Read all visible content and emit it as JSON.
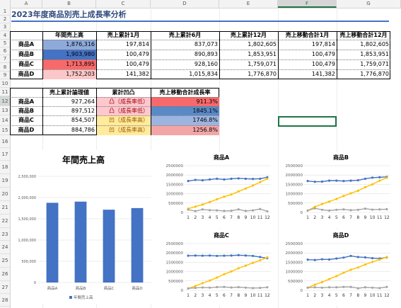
{
  "sheet": {
    "columns": [
      "A",
      "B",
      "C",
      "D",
      "E",
      "F",
      "G"
    ],
    "selected_column": "F",
    "rows": [
      "1",
      "2",
      "3",
      "4",
      "5",
      "6",
      "7",
      "8",
      "9",
      "10",
      "11",
      "12",
      "13",
      "14",
      "15",
      "16",
      "17",
      "18",
      "19",
      "20",
      "21",
      "22",
      "23",
      "24",
      "25",
      "26",
      "27",
      "28",
      "29",
      "30",
      "31",
      "32",
      "33",
      "34"
    ],
    "selected_row": "12"
  },
  "title": "2023年度商品別売上成長率分析",
  "table1": {
    "headers": [
      "年間売上高",
      "売上累計1月",
      "売上累計6月",
      "売上累計12月",
      "売上移動合計1月",
      "売上移動合計12月"
    ],
    "rows": [
      {
        "label": "商品A",
        "values": [
          "1,876,316",
          "197,814",
          "837,073",
          "1,802,605",
          "197,814",
          "1,802,605"
        ]
      },
      {
        "label": "商品B",
        "values": [
          "1,903,980",
          "100,479",
          "890,893",
          "1,853,951",
          "100,479",
          "1,853,951"
        ]
      },
      {
        "label": "商品C",
        "values": [
          "1,713,895",
          "100,479",
          "928,160",
          "1,759,071",
          "100,479",
          "1,759,071"
        ]
      },
      {
        "label": "商品D",
        "values": [
          "1,752,203",
          "141,382",
          "1,015,834",
          "1,776,870",
          "141,382",
          "1,776,870"
        ]
      }
    ],
    "b_fill": [
      "#8eaadb",
      "#4472c4",
      "#f8696b",
      "#fbc7c8"
    ]
  },
  "table2": {
    "headers": [
      "売上累計論理値",
      "累計凹凸",
      "売上移動合計成長率"
    ],
    "rows": [
      {
        "label": "商品A",
        "value": "927,264",
        "shape": "凸（成長率低）",
        "rate": "911.3%"
      },
      {
        "label": "商品B",
        "value": "897,512",
        "shape": "凸（成長率低）",
        "rate": "1845.1%"
      },
      {
        "label": "商品C",
        "value": "854,507",
        "shape": "凹（成長率高）",
        "rate": "1746.8%"
      },
      {
        "label": "商品D",
        "value": "884,786",
        "shape": "凹（成長率高）",
        "rate": "1256.8%"
      }
    ],
    "shape_fill": [
      "#ffc7ce",
      "#ffc7ce",
      "#ffeb9c",
      "#ffeb9c"
    ],
    "shape_color": [
      "#9c0006",
      "#9c0006",
      "#9c5700",
      "#9c5700"
    ],
    "rate_fill": [
      "#f8696b",
      "#5a8ac6",
      "#9cb4e0",
      "#f3a5a6"
    ]
  },
  "chart_data": [
    {
      "type": "bar",
      "title": "年間売上高",
      "categories": [
        "商品A",
        "商品B",
        "商品C",
        "商品D"
      ],
      "series": [
        {
          "name": "年間売上高",
          "values": [
            1876316,
            1903980,
            1713895,
            1752203
          ]
        }
      ],
      "ylim": [
        0,
        2500000
      ],
      "yticks": [
        "0",
        "500,000",
        "1,000,000",
        "1,500,000",
        "2,000,000",
        "2,500,000"
      ],
      "legend": "bottom",
      "colors": [
        "#4472c4"
      ]
    },
    {
      "type": "line",
      "title": "商品A",
      "x": [
        "1",
        "2",
        "3",
        "4",
        "5",
        "6",
        "7",
        "8",
        "9",
        "10",
        "11",
        "12"
      ],
      "ylim": [
        0,
        2500000
      ],
      "yticks": [
        "0",
        "500000",
        "1000000",
        "1500000",
        "2000000",
        "2500000"
      ],
      "series": [
        {
          "values": [
            1680000,
            1740000,
            1720000,
            1760000,
            1800000,
            1760000,
            1800000,
            1820000,
            1800000,
            1790000,
            1800000,
            1880000
          ]
        },
        {
          "values": [
            200000,
            310000,
            420000,
            560000,
            700000,
            840000,
            960000,
            1120000,
            1280000,
            1440000,
            1620000,
            1800000
          ]
        },
        {
          "values": [
            150000,
            70000,
            160000,
            120000,
            110000,
            80000,
            90000,
            160000,
            80000,
            110000,
            180000,
            60000
          ]
        }
      ],
      "colors": [
        "#4472c4",
        "#ffc000",
        "#a5a5a5"
      ]
    },
    {
      "type": "line",
      "title": "商品B",
      "x": [
        "1",
        "2",
        "3",
        "4",
        "5",
        "6",
        "7",
        "8",
        "9",
        "10",
        "11",
        "12"
      ],
      "ylim": [
        0,
        2500000
      ],
      "yticks": [
        "0",
        "500000",
        "1000000",
        "1500000",
        "2000000",
        "2500000"
      ],
      "series": [
        {
          "values": [
            1680000,
            1640000,
            1650000,
            1700000,
            1700000,
            1680000,
            1700000,
            1720000,
            1800000,
            1860000,
            1880000,
            1900000
          ]
        },
        {
          "values": [
            100000,
            300000,
            450000,
            580000,
            720000,
            880000,
            1020000,
            1160000,
            1350000,
            1500000,
            1700000,
            1850000
          ]
        },
        {
          "values": [
            100000,
            220000,
            140000,
            100000,
            140000,
            160000,
            120000,
            140000,
            200000,
            150000,
            160000,
            170000
          ]
        }
      ],
      "colors": [
        "#4472c4",
        "#ffc000",
        "#a5a5a5"
      ]
    },
    {
      "type": "line",
      "title": "商品C",
      "x": [
        "1",
        "2",
        "3",
        "4",
        "5",
        "6",
        "7",
        "8",
        "9",
        "10",
        "11",
        "12"
      ],
      "ylim": [
        0,
        2500000
      ],
      "yticks": [
        "0",
        "500000",
        "1000000",
        "1500000",
        "2000000",
        "2500000"
      ],
      "series": [
        {
          "values": [
            1850000,
            1860000,
            1850000,
            1860000,
            1840000,
            1850000,
            1860000,
            1880000,
            1860000,
            1840000,
            1780000,
            1720000
          ]
        },
        {
          "values": [
            100000,
            230000,
            380000,
            520000,
            680000,
            860000,
            1010000,
            1180000,
            1320000,
            1470000,
            1600000,
            1760000
          ]
        },
        {
          "values": [
            100000,
            130000,
            150000,
            140000,
            170000,
            180000,
            150000,
            170000,
            140000,
            120000,
            130000,
            160000
          ]
        }
      ],
      "colors": [
        "#4472c4",
        "#ffc000",
        "#a5a5a5"
      ]
    },
    {
      "type": "line",
      "title": "商品D",
      "x": [
        "1",
        "2",
        "3",
        "4",
        "5",
        "6",
        "7",
        "8",
        "9",
        "10",
        "11",
        "12"
      ],
      "ylim": [
        0,
        2500000
      ],
      "yticks": [
        "0",
        "500000",
        "1000000",
        "1500000",
        "2000000",
        "2500000"
      ],
      "series": [
        {
          "values": [
            1640000,
            1620000,
            1660000,
            1650000,
            1700000,
            1750000,
            1840000,
            1780000,
            1760000,
            1720000,
            1700000,
            1760000
          ]
        },
        {
          "values": [
            140000,
            300000,
            440000,
            600000,
            760000,
            940000,
            1100000,
            1220000,
            1380000,
            1520000,
            1640000,
            1780000
          ]
        },
        {
          "values": [
            140000,
            160000,
            140000,
            160000,
            160000,
            180000,
            180000,
            110000,
            160000,
            140000,
            120000,
            180000
          ]
        }
      ],
      "colors": [
        "#4472c4",
        "#ffc000",
        "#a5a5a5"
      ]
    }
  ]
}
